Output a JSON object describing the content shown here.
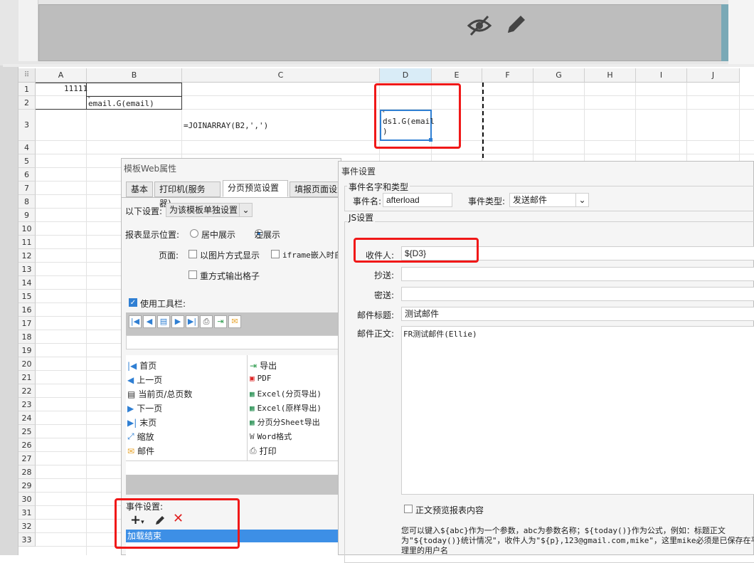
{
  "sheet": {
    "columns": [
      "A",
      "B",
      "C",
      "D",
      "E",
      "F",
      "G",
      "H",
      "I",
      "J"
    ],
    "rows": [
      "1",
      "2",
      "3",
      "4",
      "5",
      "6",
      "7",
      "8",
      "9",
      "10",
      "11",
      "12",
      "13",
      "14",
      "15",
      "16",
      "17",
      "18",
      "19",
      "20",
      "21",
      "22",
      "23",
      "24",
      "25",
      "26",
      "27",
      "28",
      "29",
      "30",
      "31",
      "32",
      "33"
    ],
    "cells": {
      "a1": "11111",
      "b2": "email.G(email)",
      "c3": "=JOINARRAY(B2,',')",
      "d3_line1": "ds1.G(email",
      "d3_line2": ")"
    }
  },
  "web_dialog": {
    "title": "模板Web属性",
    "tabs": [
      "基本",
      "打印机(服务器)",
      "分页预览设置",
      "填报页面设置"
    ],
    "setting_label": "以下设置:",
    "setting_value": "为该模板单独设置",
    "position_label": "报表显示位置:",
    "position_center": "居中展示",
    "position_left": "左展示",
    "page_label": "页面:",
    "opt_image": "以图片方式显示",
    "opt_iframe": "iframe嵌入时自",
    "opt_reprint": "重方式输出格子",
    "toolbar_label": "使用工具栏:",
    "toolbar_items_left": [
      "首页",
      "上一页",
      "当前页/总页数",
      "下一页",
      "末页",
      "缩放",
      "邮件"
    ],
    "toolbar_items_right": [
      "导出",
      "PDF",
      "Excel(分页导出)",
      "Excel(原样导出)",
      "分页分Sheet导出",
      "Word格式",
      "打印"
    ],
    "event_label": "事件设置:",
    "event_item": "加载结束"
  },
  "event_dialog": {
    "title": "事件设置",
    "section_name_type": "事件名字和类型",
    "event_name_label": "事件名:",
    "event_name_value": "afterload",
    "event_type_label": "事件类型:",
    "event_type_value": "发送邮件",
    "section_js": "JS设置",
    "to_label": "收件人:",
    "to_value": "${D3}",
    "cc_label": "抄送:",
    "cc_value": "",
    "bcc_label": "密送:",
    "bcc_value": "",
    "subject_label": "邮件标题:",
    "subject_value": "测试邮件",
    "body_label": "邮件正文:",
    "body_value": "FR测试邮件(Ellie)",
    "preview_label": "正文预览报表内容",
    "help_line1": "您可以键入${abc}作为一个参数，abc为参数名称；${today()}作为公式，例如：标题正文",
    "help_line2": "为\"${today()}统计情况\"，收件人为\"${p},123@gmail.com,mike\"，这里mike必须是已保存在平",
    "help_line3": "理里的用户名"
  },
  "colors": {
    "accent": "#2f7fd3",
    "highlight_red": "#f01818",
    "selected_event": "#3d8fe6"
  }
}
